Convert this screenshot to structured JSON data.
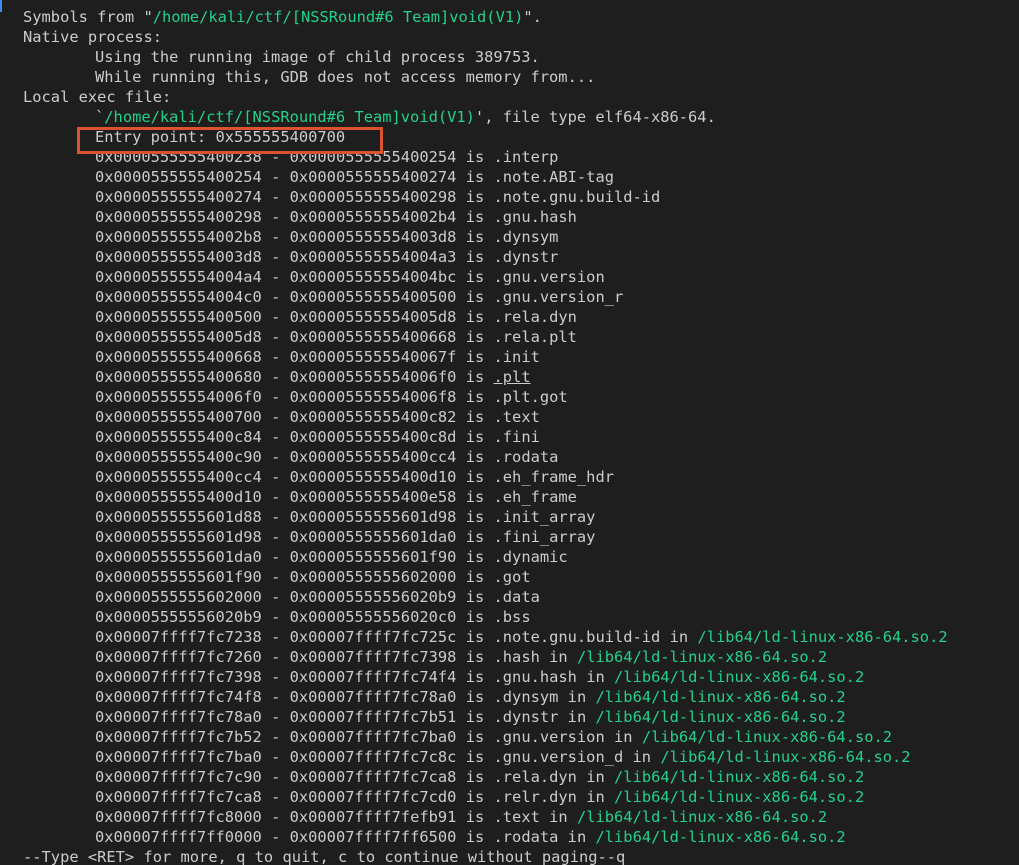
{
  "terminal": {
    "header_lines": [
      {
        "prefix": "Symbols from \"",
        "path": "/home/kali/ctf/[NSSRound#6 Team]void(V1)",
        "suffix": "\"."
      },
      {
        "text": "Native process:"
      },
      {
        "text": "Using the running image of child process 389753."
      },
      {
        "text": "While running this, GDB does not access memory from..."
      },
      {
        "text": "Local exec file:"
      },
      {
        "prefix": "`",
        "path": "/home/kali/ctf/[NSSRound#6 Team]void(V1)",
        "suffix": "', file type elf64-x86-64."
      },
      {
        "text": "Entry point: 0x555555400700"
      }
    ],
    "sections": [
      {
        "start": "0x0000555555400238",
        "end": "0x0000555555400254",
        "name": ".interp",
        "lib": ""
      },
      {
        "start": "0x0000555555400254",
        "end": "0x0000555555400274",
        "name": ".note.ABI-tag",
        "lib": ""
      },
      {
        "start": "0x0000555555400274",
        "end": "0x0000555555400298",
        "name": ".note.gnu.build-id",
        "lib": ""
      },
      {
        "start": "0x0000555555400298",
        "end": "0x00005555554002b4",
        "name": ".gnu.hash",
        "lib": ""
      },
      {
        "start": "0x00005555554002b8",
        "end": "0x00005555554003d8",
        "name": ".dynsym",
        "lib": ""
      },
      {
        "start": "0x00005555554003d8",
        "end": "0x00005555554004a3",
        "name": ".dynstr",
        "lib": ""
      },
      {
        "start": "0x00005555554004a4",
        "end": "0x00005555554004bc",
        "name": ".gnu.version",
        "lib": ""
      },
      {
        "start": "0x00005555554004c0",
        "end": "0x0000555555400500",
        "name": ".gnu.version_r",
        "lib": ""
      },
      {
        "start": "0x0000555555400500",
        "end": "0x00005555554005d8",
        "name": ".rela.dyn",
        "lib": ""
      },
      {
        "start": "0x00005555554005d8",
        "end": "0x0000555555400668",
        "name": ".rela.plt",
        "lib": ""
      },
      {
        "start": "0x0000555555400668",
        "end": "0x000055555540067f",
        "name": ".init",
        "lib": ""
      },
      {
        "start": "0x0000555555400680",
        "end": "0x00005555554006f0",
        "name": ".plt",
        "lib": "",
        "underline": true
      },
      {
        "start": "0x00005555554006f0",
        "end": "0x00005555554006f8",
        "name": ".plt.got",
        "lib": ""
      },
      {
        "start": "0x0000555555400700",
        "end": "0x0000555555400c82",
        "name": ".text",
        "lib": ""
      },
      {
        "start": "0x0000555555400c84",
        "end": "0x0000555555400c8d",
        "name": ".fini",
        "lib": ""
      },
      {
        "start": "0x0000555555400c90",
        "end": "0x0000555555400cc4",
        "name": ".rodata",
        "lib": ""
      },
      {
        "start": "0x0000555555400cc4",
        "end": "0x0000555555400d10",
        "name": ".eh_frame_hdr",
        "lib": ""
      },
      {
        "start": "0x0000555555400d10",
        "end": "0x0000555555400e58",
        "name": ".eh_frame",
        "lib": ""
      },
      {
        "start": "0x0000555555601d88",
        "end": "0x0000555555601d98",
        "name": ".init_array",
        "lib": ""
      },
      {
        "start": "0x0000555555601d98",
        "end": "0x0000555555601da0",
        "name": ".fini_array",
        "lib": ""
      },
      {
        "start": "0x0000555555601da0",
        "end": "0x0000555555601f90",
        "name": ".dynamic",
        "lib": ""
      },
      {
        "start": "0x0000555555601f90",
        "end": "0x0000555555602000",
        "name": ".got",
        "lib": ""
      },
      {
        "start": "0x0000555555602000",
        "end": "0x00005555556020b9",
        "name": ".data",
        "lib": ""
      },
      {
        "start": "0x00005555556020b9",
        "end": "0x00005555556020c0",
        "name": ".bss",
        "lib": ""
      },
      {
        "start": "0x00007ffff7fc7238",
        "end": "0x00007ffff7fc725c",
        "name": ".note.gnu.build-id",
        "lib": "/lib64/ld-linux-x86-64.so.2"
      },
      {
        "start": "0x00007ffff7fc7260",
        "end": "0x00007ffff7fc7398",
        "name": ".hash",
        "lib": "/lib64/ld-linux-x86-64.so.2"
      },
      {
        "start": "0x00007ffff7fc7398",
        "end": "0x00007ffff7fc74f4",
        "name": ".gnu.hash",
        "lib": "/lib64/ld-linux-x86-64.so.2"
      },
      {
        "start": "0x00007ffff7fc74f8",
        "end": "0x00007ffff7fc78a0",
        "name": ".dynsym",
        "lib": "/lib64/ld-linux-x86-64.so.2"
      },
      {
        "start": "0x00007ffff7fc78a0",
        "end": "0x00007ffff7fc7b51",
        "name": ".dynstr",
        "lib": "/lib64/ld-linux-x86-64.so.2"
      },
      {
        "start": "0x00007ffff7fc7b52",
        "end": "0x00007ffff7fc7ba0",
        "name": ".gnu.version",
        "lib": "/lib64/ld-linux-x86-64.so.2"
      },
      {
        "start": "0x00007ffff7fc7ba0",
        "end": "0x00007ffff7fc7c8c",
        "name": ".gnu.version_d",
        "lib": "/lib64/ld-linux-x86-64.so.2"
      },
      {
        "start": "0x00007ffff7fc7c90",
        "end": "0x00007ffff7fc7ca8",
        "name": ".rela.dyn",
        "lib": "/lib64/ld-linux-x86-64.so.2"
      },
      {
        "start": "0x00007ffff7fc7ca8",
        "end": "0x00007ffff7fc7cd0",
        "name": ".relr.dyn",
        "lib": "/lib64/ld-linux-x86-64.so.2"
      },
      {
        "start": "0x00007ffff7fc8000",
        "end": "0x00007ffff7fefb91",
        "name": ".text",
        "lib": "/lib64/ld-linux-x86-64.so.2"
      },
      {
        "start": "0x00007ffff7ff0000",
        "end": "0x00007ffff7ff6500",
        "name": ".rodata",
        "lib": "/lib64/ld-linux-x86-64.so.2"
      }
    ],
    "is_word": "is",
    "in_word": "in",
    "pager_prompt": "--Type <RET> for more, q to quit, c to continue without paging--q",
    "colors": {
      "background": "#1e1e1e",
      "text": "#cccccc",
      "path": "#23d18b",
      "highlight_box": "#d9532c"
    }
  }
}
